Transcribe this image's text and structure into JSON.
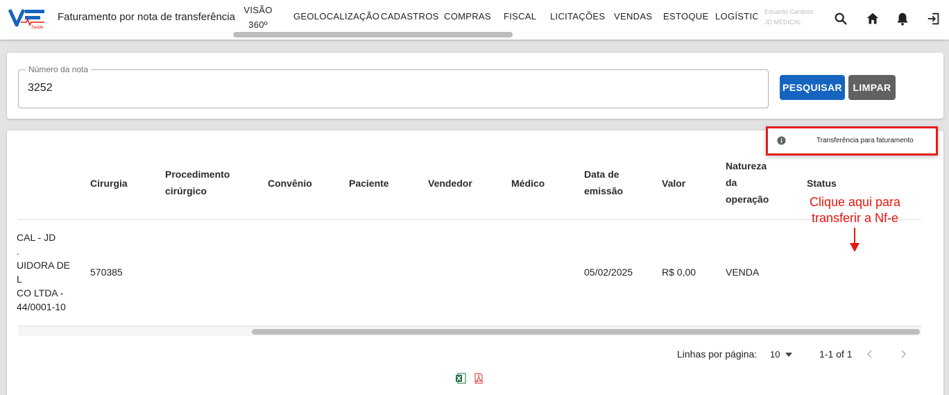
{
  "header": {
    "logo_text": "V Saúde",
    "title": "Faturamento por nota de transferência",
    "nav": [
      {
        "label": "VISÃO 360º"
      },
      {
        "label": "GEOLOCALIZAÇÃO"
      },
      {
        "label": "CADASTROS"
      },
      {
        "label": "COMPRAS"
      },
      {
        "label": "FISCAL"
      },
      {
        "label": "LICITAÇÕES"
      },
      {
        "label": "VENDAS"
      },
      {
        "label": "ESTOQUE"
      },
      {
        "label": "LOGÍSTICA"
      }
    ],
    "user": {
      "name": "Eduardo Cardoso",
      "company": "JD MEDICAL"
    },
    "icons": [
      "search-icon",
      "home-icon",
      "bell-icon",
      "logout-icon"
    ]
  },
  "search": {
    "label": "Número da nota",
    "value": "3252",
    "search_button": "PESQUISAR",
    "clear_button": "LIMPAR"
  },
  "table": {
    "columns": {
      "cirurgia": "Cirurgia",
      "procedimento": [
        "Procedimento",
        "cirúrgico"
      ],
      "convenio": "Convênio",
      "paciente": "Paciente",
      "vendedor": "Vendedor",
      "medico": "Médico",
      "data_emissao": [
        "Data de",
        "emissão"
      ],
      "valor": "Valor",
      "natureza": [
        "Natureza",
        "da",
        "operação"
      ],
      "status": "Status"
    },
    "rows": [
      {
        "partial_text": [
          "CAL - JD",
          ".",
          "UIDORA DE",
          "L",
          "CO LTDA -",
          "44/0001-10"
        ],
        "cirurgia": "570385",
        "procedimento": "",
        "convenio": "",
        "paciente": "",
        "vendedor": "",
        "medico": "",
        "data_emissao": "05/02/2025",
        "valor": "R$ 0,00",
        "natureza": "VENDA"
      }
    ]
  },
  "callout": [
    "Clique aqui para",
    "transferir a Nf-e"
  ],
  "callout_color": "#e8160c",
  "action_menu": {
    "label": "Transferência para faturamento",
    "icon": "info-icon"
  },
  "pagination": {
    "rows_label": "Linhas por página:",
    "rows_per_page": "10",
    "range": "1-1 of 1"
  },
  "export": {
    "icons": [
      "excel-icon",
      "pdf-icon"
    ]
  },
  "colors": {
    "primary": "#1565c0",
    "secondary": "#616161",
    "highlight": "#e41d1d"
  }
}
